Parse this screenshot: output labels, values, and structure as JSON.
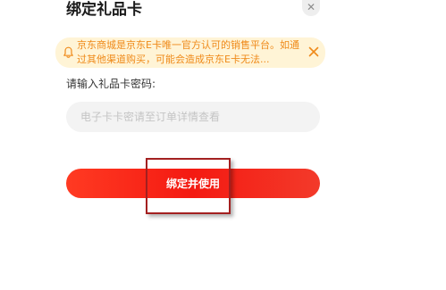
{
  "dialog": {
    "title": "绑定礼品卡",
    "close_icon": "close-icon"
  },
  "notice": {
    "icon": "bell-icon",
    "text": "京东商城是京东E卡唯一官方认可的销售平台。如通过其他渠道购买，可能会造成京东E卡无法...",
    "close_icon": "close-icon",
    "text_color": "#ef8a1a",
    "background": "#fff4d6"
  },
  "form": {
    "label": "请输入礼品卡密码:",
    "input_placeholder": "电子卡卡密请至订单详情查看",
    "input_value": "",
    "submit_label": "绑定并使用"
  },
  "colors": {
    "accent": "#f41a12",
    "highlight_box": "#a32020"
  }
}
